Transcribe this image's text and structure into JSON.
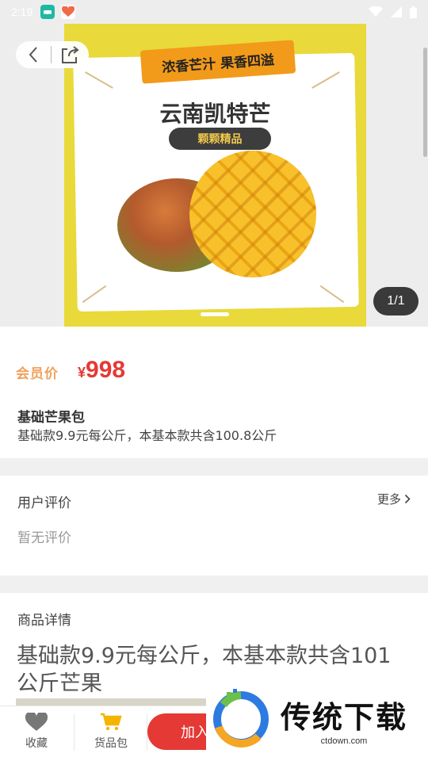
{
  "status_bar": {
    "time": "2:19",
    "app_icons": [
      "car-app-icon",
      "heart-app-icon"
    ],
    "system_icons": [
      "wifi-icon",
      "signal-icon",
      "battery-icon"
    ]
  },
  "hero": {
    "banner_text": "浓香芒汁 果香四溢",
    "title": "云南凯特芒",
    "pill_text": "颗颗精品",
    "counter": "1/1"
  },
  "price_section": {
    "member_label": "会员价",
    "currency": "¥",
    "price": "998",
    "product_name": "基础芒果包",
    "product_desc": "基础款9.9元每公斤，本基本款共含100.8公斤"
  },
  "reviews": {
    "title": "用户评价",
    "more_label": "更多",
    "empty_text": "暂无评价"
  },
  "details": {
    "title": "商品详情",
    "text": "基础款9.9元每公斤，本基本款共含101公斤芒果"
  },
  "bottom_bar": {
    "favorite_label": "收藏",
    "cart_label": "货品包",
    "add_button_label": "加入"
  },
  "watermark": {
    "title": "传统下载",
    "url": "ctdown.com"
  },
  "colors": {
    "accent_red": "#e53935",
    "member_orange": "#f0a15c",
    "cart_yellow": "#f5b400"
  }
}
